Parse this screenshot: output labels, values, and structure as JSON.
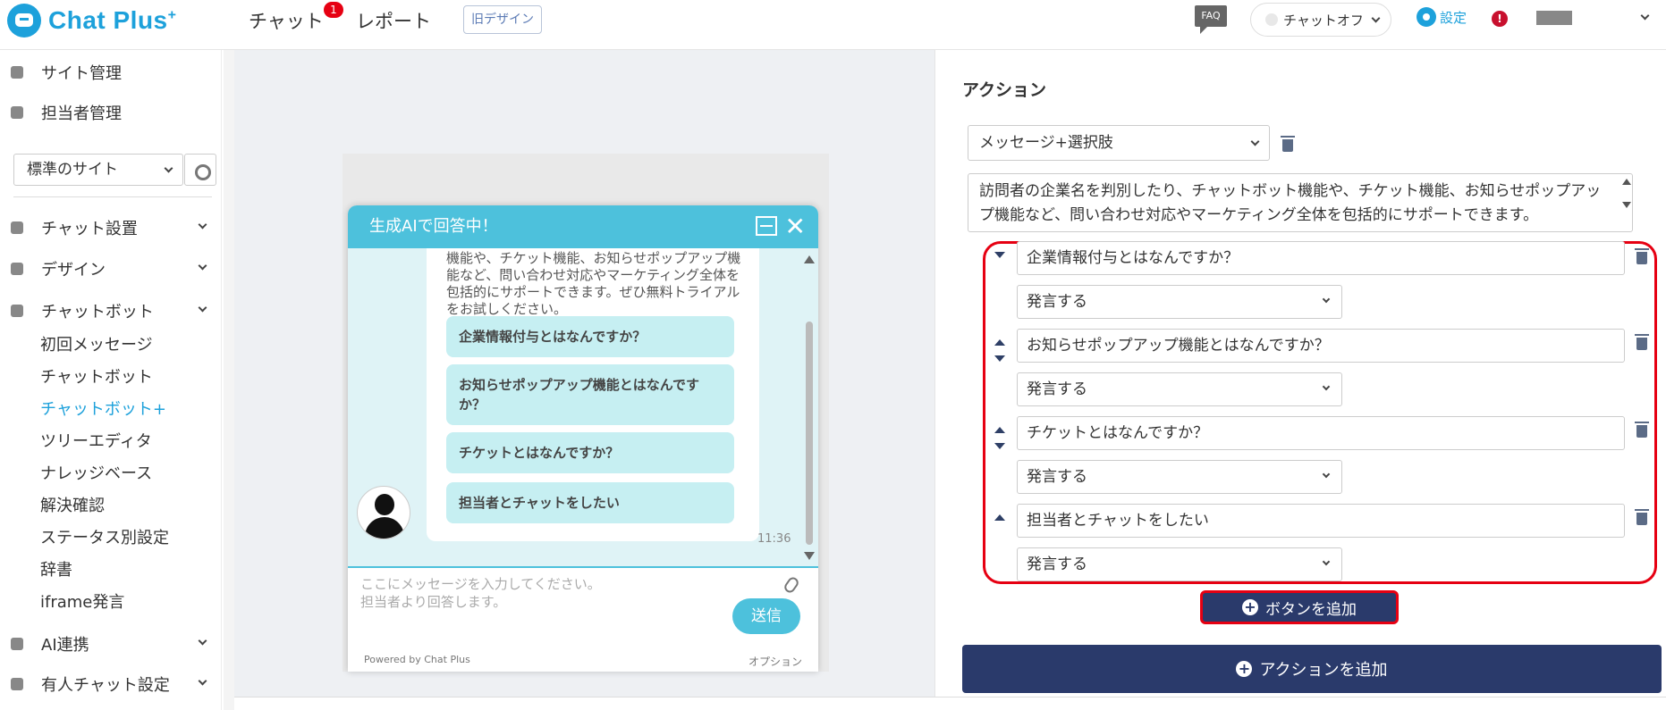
{
  "topbar": {
    "logo_text": "Chat Plus",
    "logo_sup": "+",
    "nav_chat": "チャット",
    "chat_badge": "1",
    "nav_report": "レポート",
    "old_design": "旧デザイン",
    "faq": "FAQ",
    "status": "チャットオフ",
    "settings": "設定",
    "alert": "!"
  },
  "sidebar": {
    "site_admin": "サイト管理",
    "staff_admin": "担当者管理",
    "site_select": "標準のサイト",
    "chat_setup": "チャット設置",
    "design": "デザイン",
    "chatbot": "チャットボット",
    "sub": [
      "初回メッセージ",
      "チャットボット",
      "チャットボット+",
      "ツリーエディタ",
      "ナレッジベース",
      "解決確認",
      "ステータス別設定",
      "辞書",
      "iframe発言"
    ],
    "ai": "AI連携",
    "manned": "有人チャット設定"
  },
  "widget": {
    "header": "生成AIで回答中！",
    "bubble_text": "機能や、チケット機能、お知らせポップアップ機能など、問い合わせ対応やマーケティング全体を包括的にサポートできます。ぜひ無料トライアルをお試しください。",
    "choices": [
      "企業情報付与とはなんですか？",
      "お知らせポップアップ機能とはなんですか？",
      "チケットとはなんですか？",
      "担当者とチャットをしたい"
    ],
    "time": "11:36",
    "input_placeholder_1": "ここにメッセージを入力してください。",
    "input_placeholder_2": "担当者より回答します。",
    "send": "送信",
    "powered": "Powered by Chat Plus",
    "option": "オプション"
  },
  "action": {
    "title": "アクション",
    "type": "メッセージ+選択肢",
    "message": "訪問者の企業名を判別したり、チャットボット機能や、チケット機能、お知らせポップアップ機能など、問い合わせ対応やマーケティング全体を包括的にサポートできます。",
    "buttons": [
      {
        "label": "企業情報付与とはなんですか？",
        "behavior": "発言する"
      },
      {
        "label": "お知らせポップアップ機能とはなんですか？",
        "behavior": "発言する"
      },
      {
        "label": "チケットとはなんですか？",
        "behavior": "発言する"
      },
      {
        "label": "担当者とチャットをしたい",
        "behavior": "発言する"
      }
    ],
    "add_button": "ボタンを追加",
    "add_action": "アクションを追加"
  },
  "colors": {
    "accent": "#1da1db",
    "navy": "#2a3a6b",
    "widget": "#4dc1dc",
    "highlight": "#e60012"
  }
}
